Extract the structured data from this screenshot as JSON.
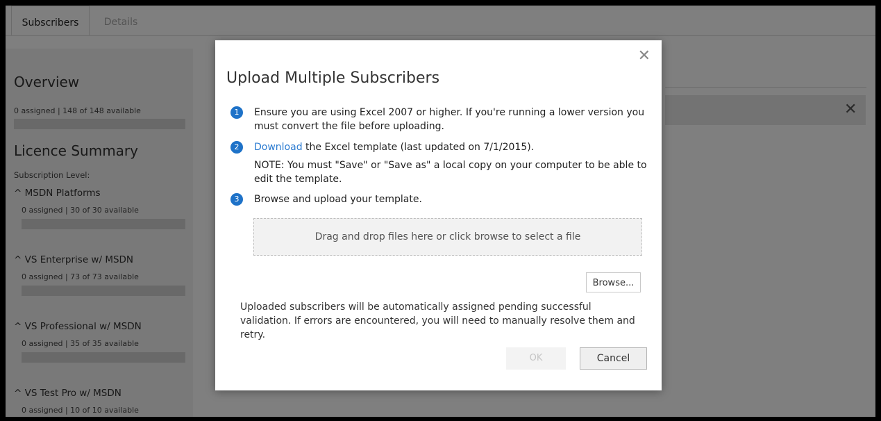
{
  "tabs": {
    "subscribers": "Subscribers",
    "details": "Details"
  },
  "sidebar": {
    "overview_title": "Overview",
    "overview_stats": "0 assigned | 148 of 148 available",
    "licence_title": "Licence Summary",
    "subscription_level": "Subscription Level:",
    "items": [
      {
        "label": "^ MSDN Platforms",
        "stats": "0 assigned | 30 of 30 available"
      },
      {
        "label": "^ VS Enterprise w/ MSDN",
        "stats": "0 assigned | 73 of 73 available"
      },
      {
        "label": "^ VS Professional w/ MSDN",
        "stats": "0 assigned | 35 of 35 available"
      },
      {
        "label": "^ VS Test Pro w/ MSDN",
        "stats": "0 assigned | 10 of 10 available"
      }
    ]
  },
  "main": {
    "close_glyph": "✕"
  },
  "modal": {
    "close_glyph": "✕",
    "title": "Upload Multiple Subscribers",
    "steps": [
      {
        "num": "1",
        "text": "Ensure you are using Excel 2007 or higher. If you're running a lower version you must convert the file before uploading."
      },
      {
        "num": "2",
        "link": "Download",
        "text": " the Excel template (last updated on 7/1/2015).",
        "note": "NOTE: You must \"Save\" or \"Save as\" a local copy on your computer to be able to edit the template."
      },
      {
        "num": "3",
        "text": "Browse and upload your template."
      }
    ],
    "dropzone": "Drag and drop files here or click browse to select a file",
    "browse_label": "Browse...",
    "info": "Uploaded subscribers will be automatically assigned pending successful validation. If errors are encountered, you will need to manually resolve them and retry.",
    "ok_label": "OK",
    "cancel_label": "Cancel"
  },
  "colors": {
    "accent": "#1e72c8",
    "link": "#2b7bd1"
  }
}
